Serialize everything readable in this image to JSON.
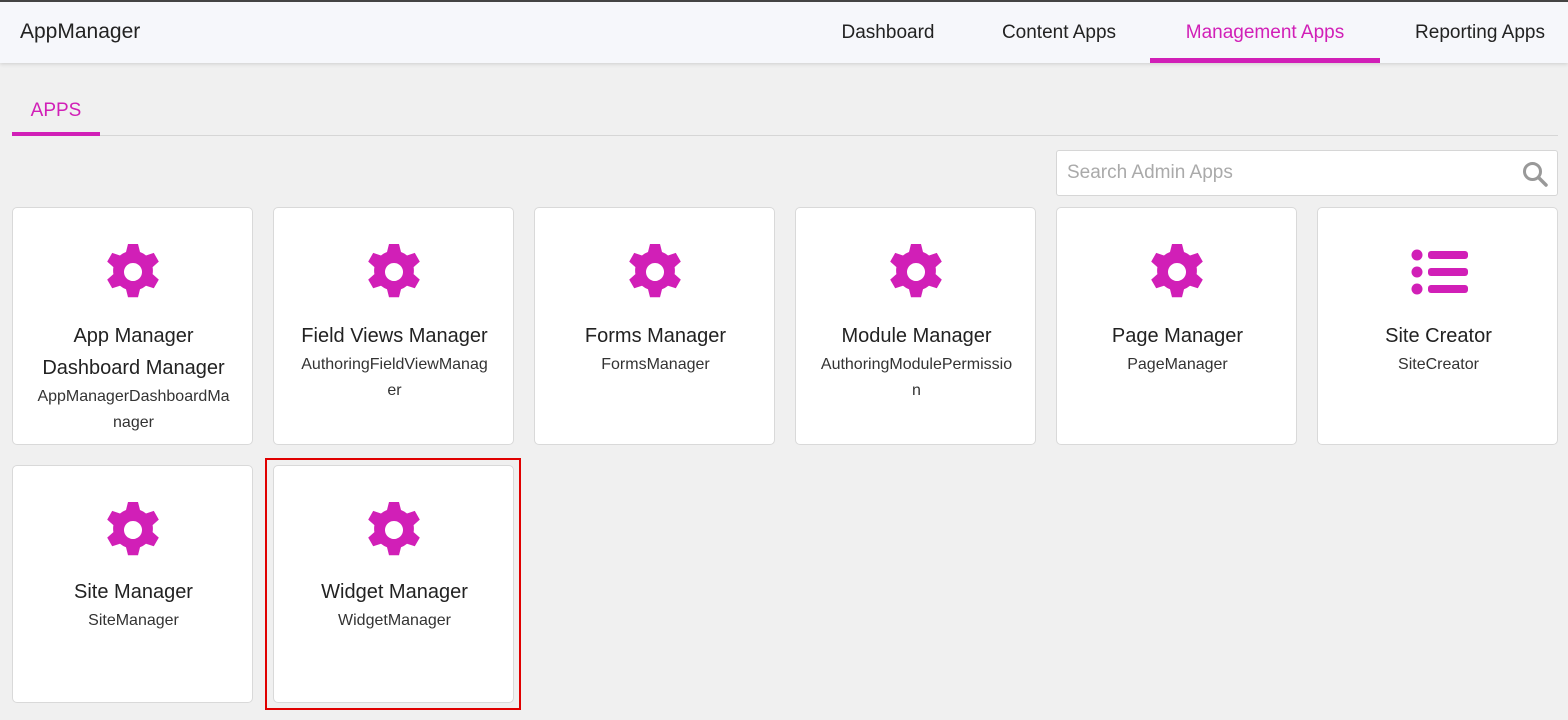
{
  "app": {
    "title": "AppManager"
  },
  "nav": {
    "items": [
      {
        "label": "Dashboard"
      },
      {
        "label": "Content Apps"
      },
      {
        "label": "Management Apps"
      },
      {
        "label": "Reporting Apps"
      }
    ],
    "active": "Management Apps"
  },
  "tabs": {
    "apps_label": "APPS"
  },
  "search": {
    "placeholder": "Search Admin Apps",
    "value": ""
  },
  "cards": [
    {
      "title": "App Manager Dashboard Manager",
      "code": "AppManagerDashboardManager",
      "icon": "gear-icon"
    },
    {
      "title": "Field Views Manager",
      "code": "AuthoringFieldViewManager",
      "icon": "gear-icon"
    },
    {
      "title": "Forms Manager",
      "code": "FormsManager",
      "icon": "gear-icon"
    },
    {
      "title": "Module Manager",
      "code": "AuthoringModulePermission",
      "icon": "gear-icon"
    },
    {
      "title": "Page Manager",
      "code": "PageManager",
      "icon": "gear-icon"
    },
    {
      "title": "Site Creator",
      "code": "SiteCreator",
      "icon": "list-icon"
    },
    {
      "title": "Site Manager",
      "code": "SiteManager",
      "icon": "gear-icon"
    },
    {
      "title": "Widget Manager",
      "code": "WidgetManager",
      "icon": "gear-icon"
    }
  ],
  "colors": {
    "accent": "#d11fb7",
    "highlight": "#e00000"
  }
}
